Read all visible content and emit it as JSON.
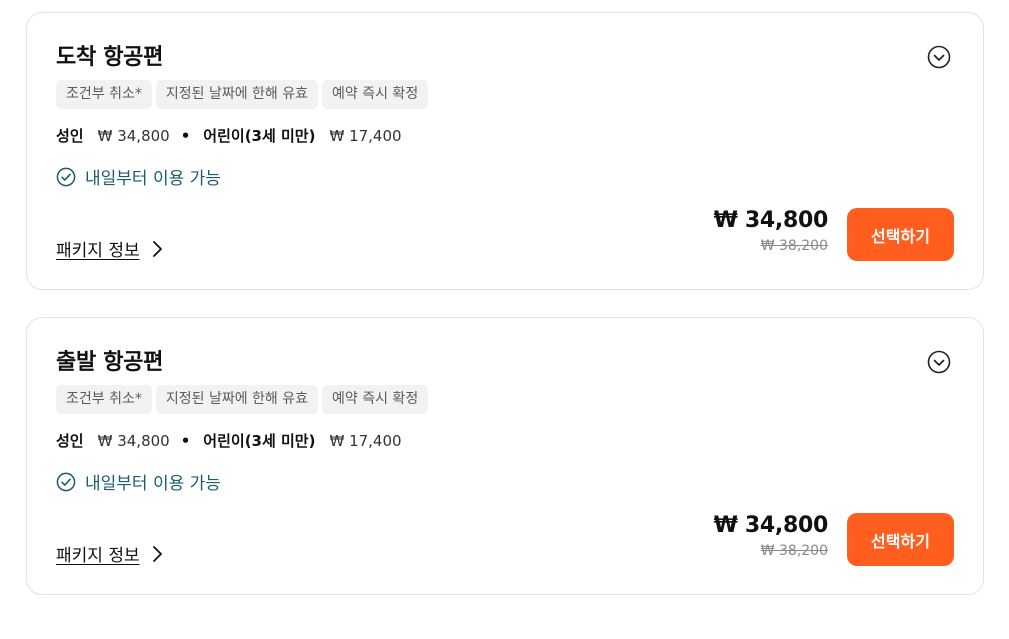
{
  "cards": [
    {
      "title": "도착 항공편",
      "tags": [
        "조건부 취소*",
        "지정된 날짜에 한해 유효",
        "예약 즉시 확정"
      ],
      "adult_label": "성인",
      "adult_price": "₩ 34,800",
      "child_label": "어린이(3세 미만)",
      "child_price": "₩ 17,400",
      "separator": "•",
      "availability": "내일부터 이용 가능",
      "package_link": "패키지 정보",
      "price_current": "₩ 34,800",
      "price_original": "₩ 38,200",
      "select_label": "선택하기"
    },
    {
      "title": "출발 항공편",
      "tags": [
        "조건부 취소*",
        "지정된 날짜에 한해 유효",
        "예약 즉시 확정"
      ],
      "adult_label": "성인",
      "adult_price": "₩ 34,800",
      "child_label": "어린이(3세 미만)",
      "child_price": "₩ 17,400",
      "separator": "•",
      "availability": "내일부터 이용 가능",
      "package_link": "패키지 정보",
      "price_current": "₩ 34,800",
      "price_original": "₩ 38,200",
      "select_label": "선택하기"
    }
  ],
  "icons": {
    "expand": "chevron-down-circle-icon",
    "availability": "check-circle-icon",
    "package": "chevron-right-icon"
  },
  "colors": {
    "accent": "#ff5e1f",
    "availability": "#1b5e6b",
    "tag_bg": "#f2f2f2",
    "border": "#e3e3e3"
  }
}
